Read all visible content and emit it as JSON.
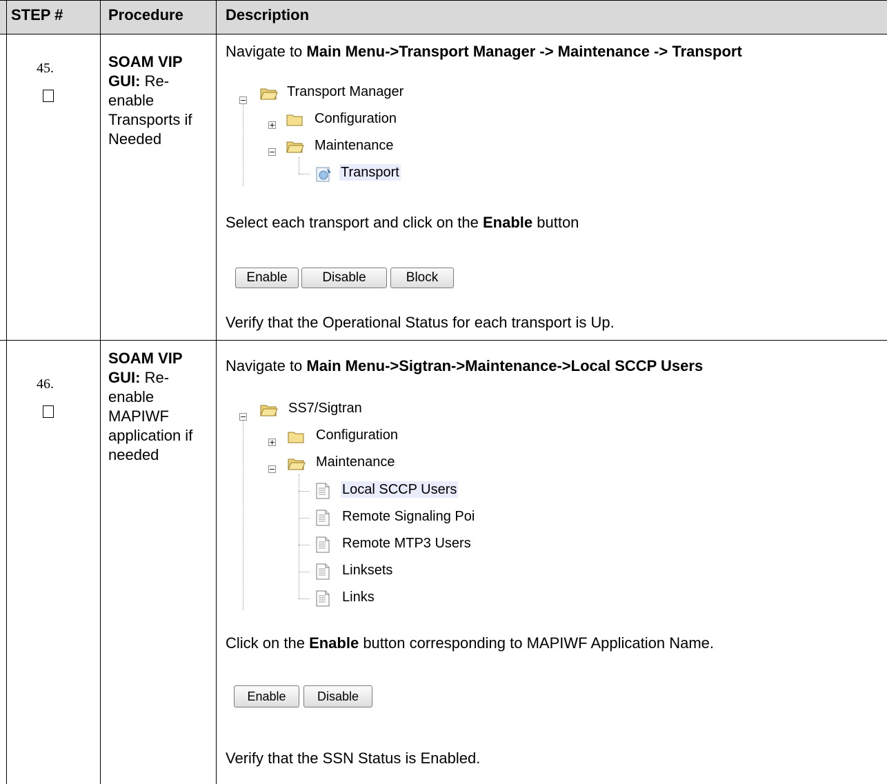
{
  "header": {
    "step": "STEP #",
    "procedure": "Procedure",
    "description": "Description"
  },
  "rows": [
    {
      "step_number": "45.",
      "procedure_bold": "SOAM VIP GUI:",
      "procedure_text": "Re-enable Transports if Needed",
      "navigate_prefix": "Navigate to ",
      "navigate_path": "Main Menu->Transport Manager -> Maintenance -> Transport",
      "tree": {
        "root": "Transport Manager",
        "configuration": "Configuration",
        "maintenance": "Maintenance",
        "leaf": "Transport"
      },
      "select_prefix": "Select each transport and click on the ",
      "select_bold": "Enable",
      "select_suffix": " button",
      "buttons": [
        "Enable",
        "Disable",
        "Block"
      ],
      "verify": "Verify that the Operational Status for each transport is Up."
    },
    {
      "step_number": "46.",
      "procedure_bold": "SOAM VIP GUI:",
      "procedure_text": "Re-enable MAPIWF application if needed",
      "navigate_prefix": "Navigate to ",
      "navigate_path": "Main Menu->Sigtran->Maintenance->Local SCCP Users",
      "tree": {
        "root": "SS7/Sigtran",
        "configuration": "Configuration",
        "maintenance": "Maintenance",
        "leaves": [
          "Local SCCP Users",
          "Remote Signaling Poi",
          "Remote MTP3 Users",
          "Linksets",
          "Links"
        ]
      },
      "click_prefix": "Click on the ",
      "click_bold": "Enable",
      "click_suffix": " button corresponding to MAPIWF Application Name.",
      "buttons": [
        "Enable",
        "Disable"
      ],
      "verify": "Verify that the SSN Status is Enabled."
    }
  ]
}
